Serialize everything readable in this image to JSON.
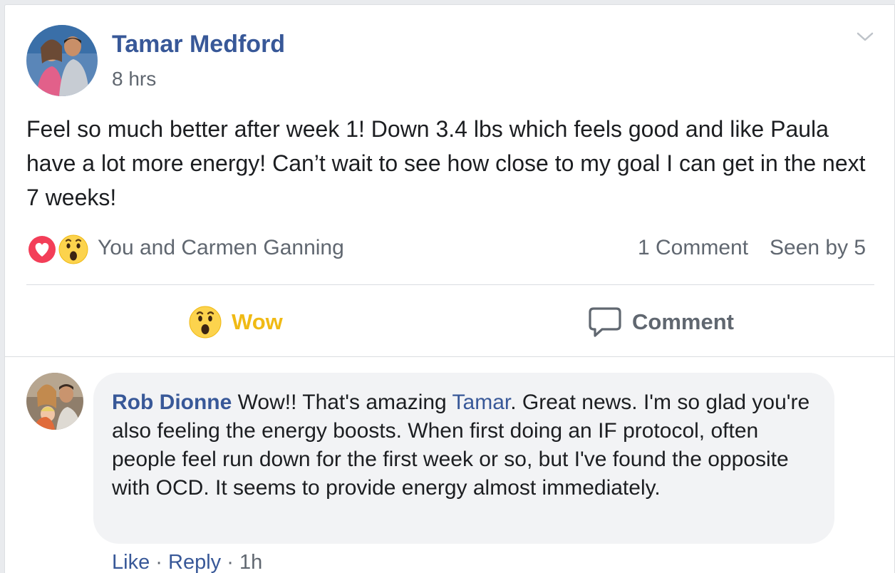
{
  "post": {
    "author": "Tamar Medford",
    "time": "8 hrs",
    "text": "Feel so much better after week 1! Down 3.4 lbs which feels good and like Paula have a lot more energy! Can’t wait to see how close to my goal I can get in the next 7 weeks!",
    "reactors": "You and Carmen Ganning",
    "comment_count": "1 Comment",
    "seen_by": "Seen by 5"
  },
  "actions": {
    "wow_label": "Wow",
    "comment_label": "Comment"
  },
  "comment": {
    "author": "Rob Dionne",
    "text_before": "Wow!! That's amazing",
    "mention": "Tamar",
    "text_after": ". Great news. I'm so glad you're also feeling the energy boosts. When first doing an IF protocol, often people feel run down for the first week or so, but I've found the opposite with OCD. It seems to provide energy almost immediately.",
    "like_label": "Like",
    "reply_label": "Reply",
    "separator": "·",
    "time": "1h"
  },
  "colors": {
    "link_blue": "#385898",
    "wow_yellow": "#f0ba15",
    "love_red": "#f33e58",
    "meta_gray": "#606770"
  },
  "icons": [
    "love-reaction-icon",
    "wow-reaction-icon",
    "chevron-down-icon",
    "comment-bubble-icon"
  ]
}
